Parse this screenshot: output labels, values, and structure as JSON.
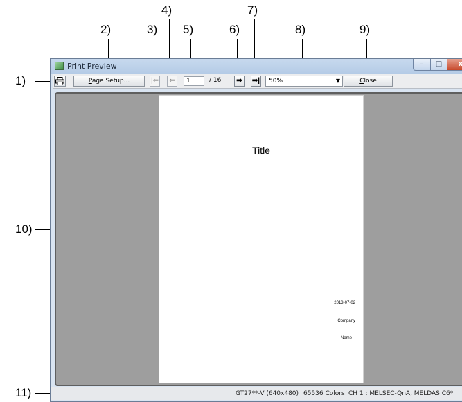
{
  "callouts": [
    "1)",
    "2)",
    "3)",
    "4)",
    "5)",
    "6)",
    "7)",
    "8)",
    "9)",
    "10)",
    "11)"
  ],
  "window": {
    "title": "Print Preview",
    "controls": {
      "minimize": "–",
      "maximize": "□",
      "close": "x"
    }
  },
  "toolbar": {
    "print_icon": "printer-icon",
    "page_setup": {
      "accel": "P",
      "rest": "age Setup..."
    },
    "first_page_icon": "first-page-icon",
    "prev_page_icon": "previous-page-icon",
    "page_number": "1",
    "page_total": "/ 16",
    "next_page_icon": "next-page-icon",
    "last_page_icon": "last-page-icon",
    "zoom": "50%",
    "close": {
      "accel": "C",
      "rest": "lose"
    }
  },
  "page": {
    "title": "Title",
    "date": "2013-07-02",
    "company": "Company",
    "name": "Name"
  },
  "statusbar": {
    "model": "GT27**-V (640x480)",
    "colors": "65536 Colors",
    "channel": "CH 1 : MELSEC-QnA, MELDAS C6*"
  }
}
